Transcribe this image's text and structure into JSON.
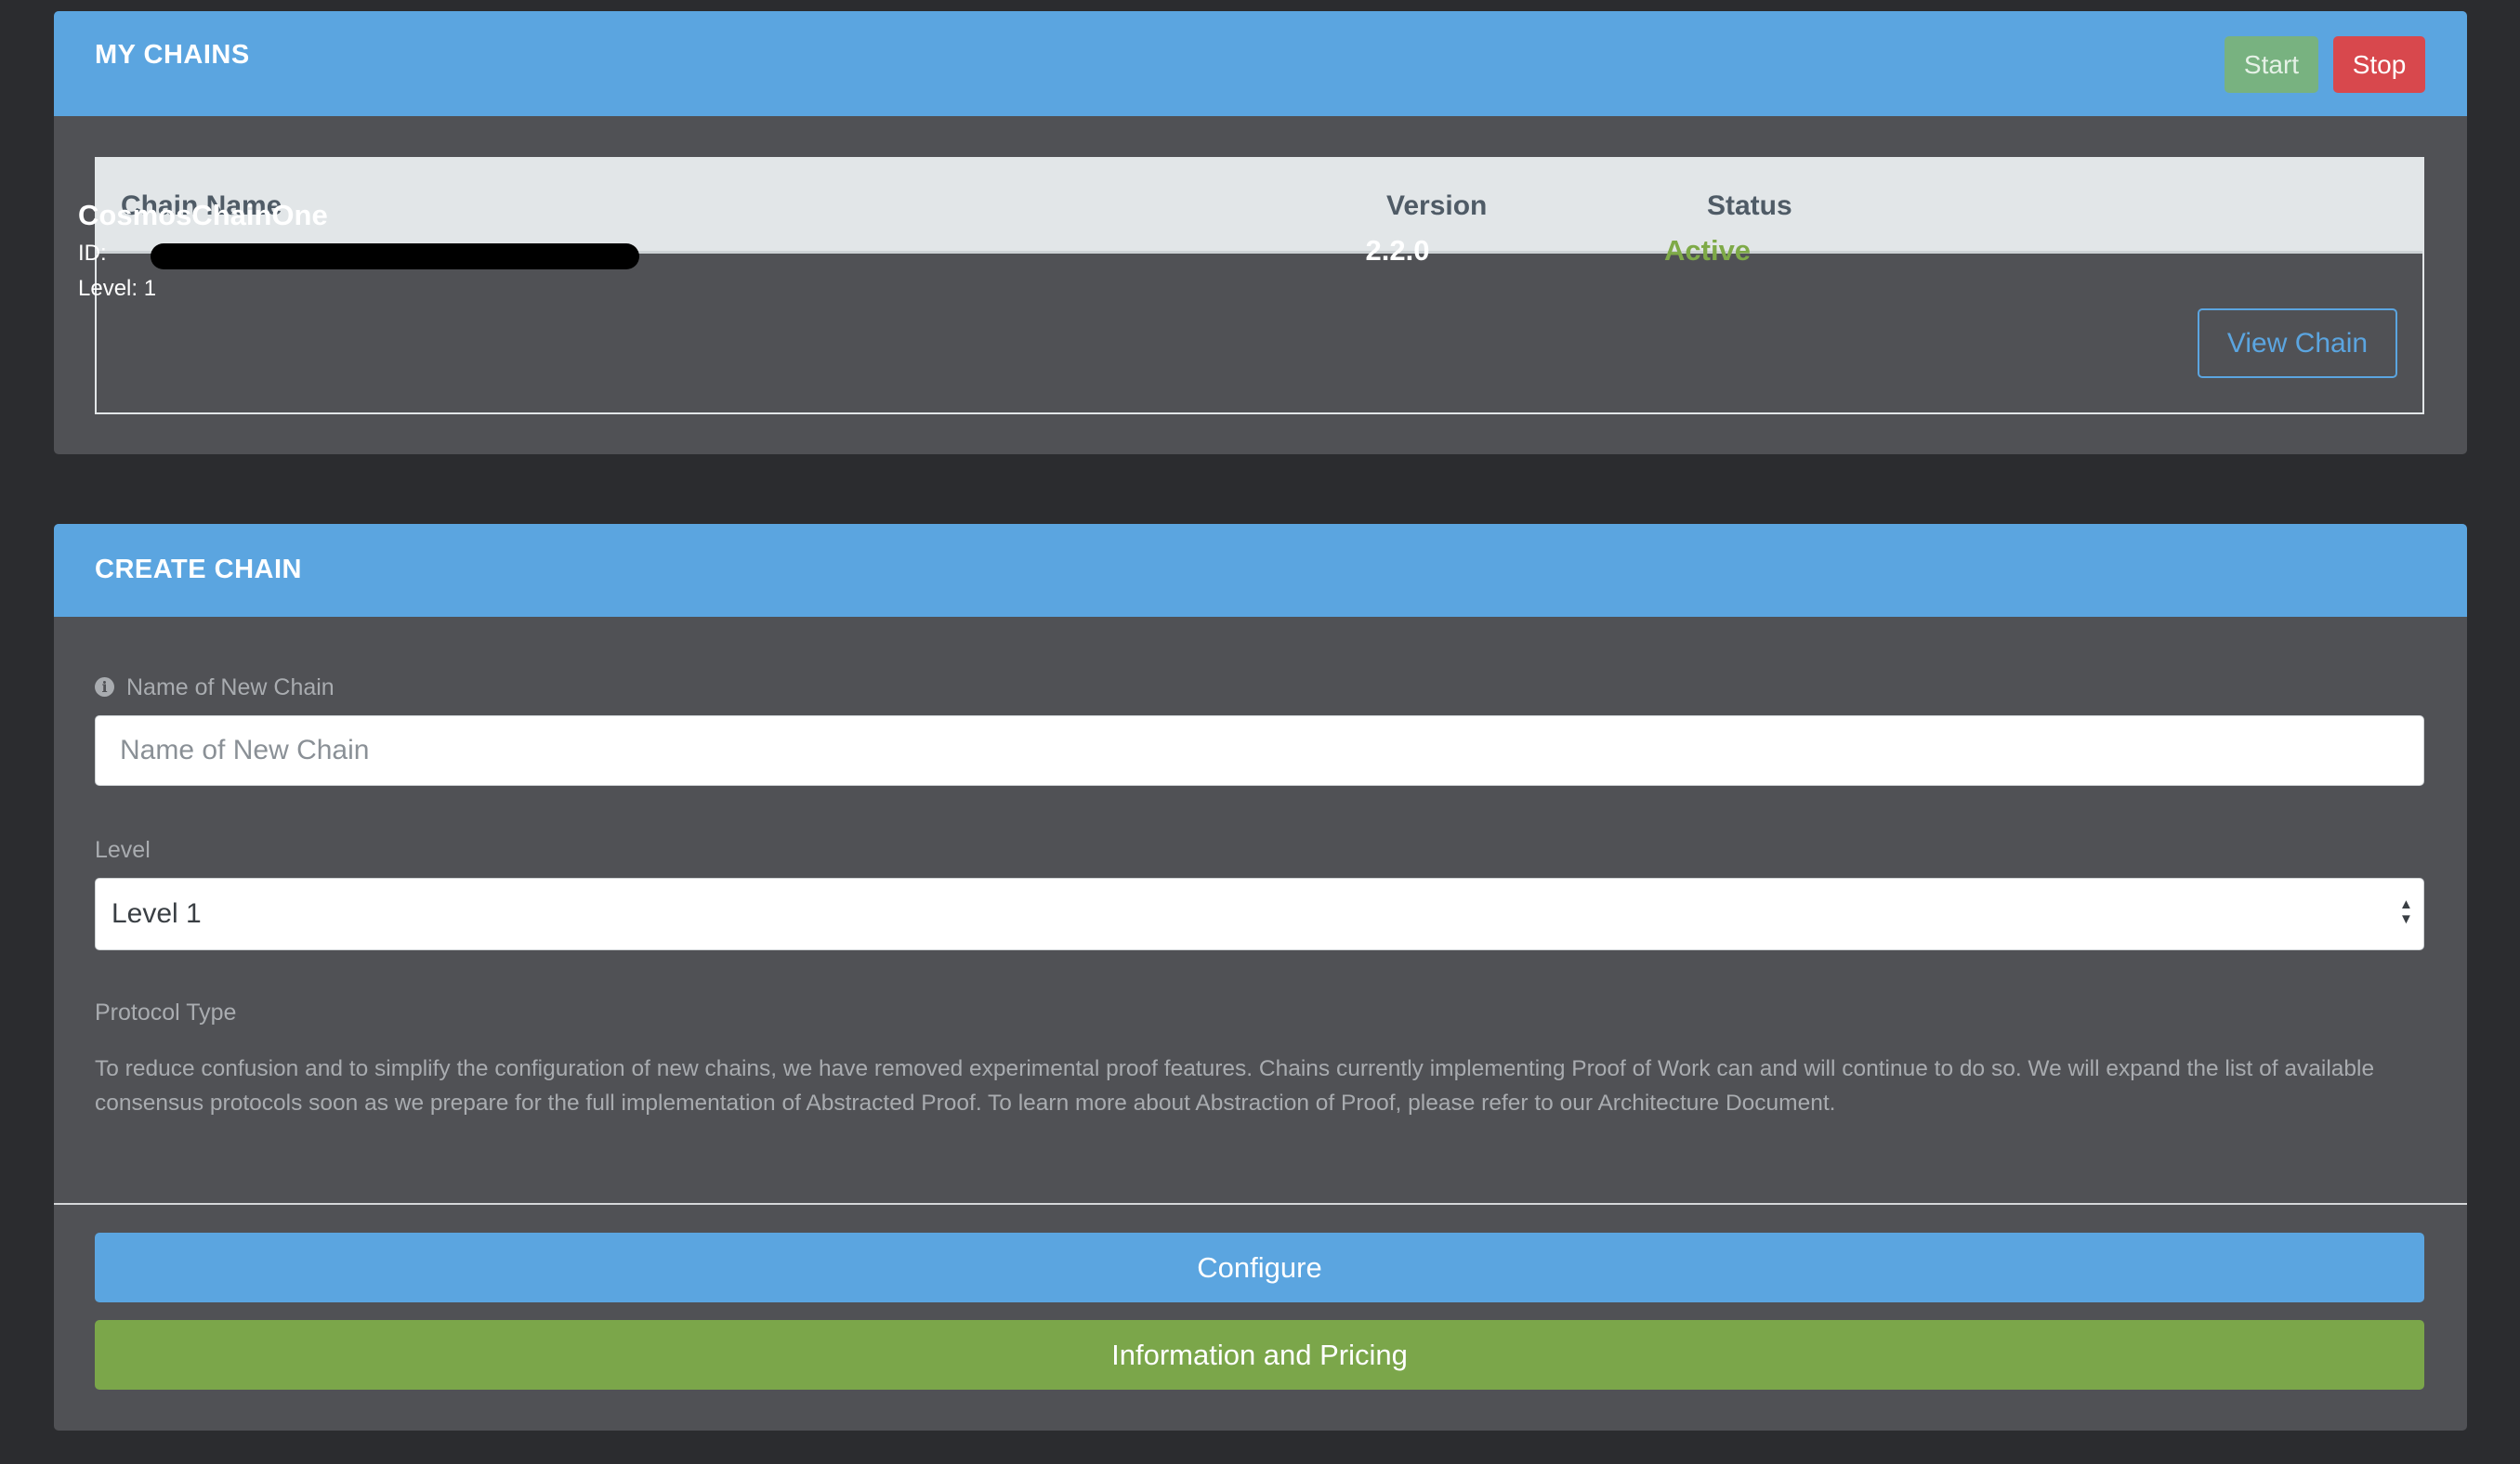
{
  "colors": {
    "page_background": "#2b2c2f",
    "panel_background": "#505155",
    "accent_blue": "#5ba5e0",
    "success_green": "#7ba64a",
    "danger_red": "#d8484d",
    "start_green": "#78b280",
    "status_active": "#7eaa48"
  },
  "my_chains": {
    "title": "MY CHAINS",
    "start_label": "Start",
    "stop_label": "Stop",
    "table": {
      "headers": {
        "name": "Chain Name",
        "version": "Version",
        "status": "Status"
      },
      "rows": [
        {
          "name": "CosmosChainOne",
          "id_label": "ID:",
          "level": "Level: 1",
          "version": "2.2.0",
          "status": "Active",
          "action_label": "View Chain"
        }
      ]
    }
  },
  "create_chain": {
    "title": "CREATE CHAIN",
    "name_field": {
      "label": "Name of New Chain",
      "placeholder": "Name of New Chain",
      "value": "",
      "icon": "info-icon"
    },
    "level_field": {
      "label": "Level",
      "selected": "Level 1"
    },
    "protocol": {
      "label": "Protocol Type",
      "description": "To reduce confusion and to simplify the configuration of new chains, we have removed experimental proof features. Chains currently implementing Proof of Work can and will continue to do so. We will expand the list of available consensus protocols soon as we prepare for the full implementation of Abstracted Proof. To learn more about Abstraction of Proof, please refer to our Architecture Document."
    },
    "configure_label": "Configure",
    "info_pricing_label": "Information and Pricing"
  }
}
